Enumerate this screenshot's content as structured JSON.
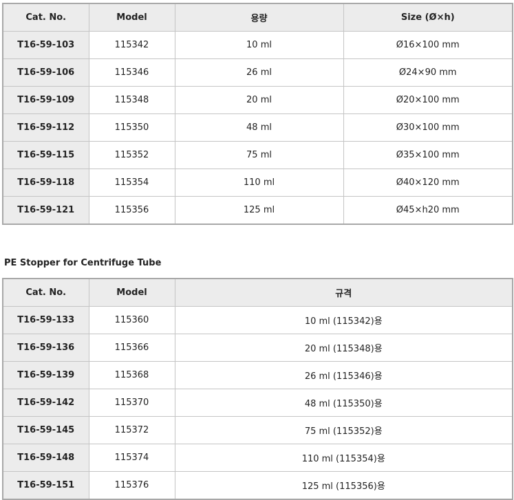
{
  "table1": {
    "headers": [
      "Cat. No.",
      "Model",
      "용량",
      "Size (Ø×h)"
    ],
    "rows": [
      [
        "T16-59-103",
        "115342",
        "10 ml",
        "Ø16×100 mm"
      ],
      [
        "T16-59-106",
        "115346",
        "26 ml",
        "Ø24×90 mm"
      ],
      [
        "T16-59-109",
        "115348",
        "20 ml",
        "Ø20×100 mm"
      ],
      [
        "T16-59-112",
        "115350",
        "48 ml",
        "Ø30×100 mm"
      ],
      [
        "T16-59-115",
        "115352",
        "75 ml",
        "Ø35×100 mm"
      ],
      [
        "T16-59-118",
        "115354",
        "110 ml",
        "Ø40×120 mm"
      ],
      [
        "T16-59-121",
        "115356",
        "125 ml",
        "Ø45×h20 mm"
      ]
    ]
  },
  "section2_title": "PE Stopper for Centrifuge Tube",
  "table2": {
    "headers": [
      "Cat. No.",
      "Model",
      "규격"
    ],
    "rows": [
      [
        "T16-59-133",
        "115360",
        "10 ml (115342)용"
      ],
      [
        "T16-59-136",
        "115366",
        "20 ml (115348)용"
      ],
      [
        "T16-59-139",
        "115368",
        "26 ml (115346)용"
      ],
      [
        "T16-59-142",
        "115370",
        "48 ml (115350)용"
      ],
      [
        "T16-59-145",
        "115372",
        "75 ml (115352)용"
      ],
      [
        "T16-59-148",
        "115374",
        "110 ml (115354)용"
      ],
      [
        "T16-59-151",
        "115376",
        "125 ml (115356)용"
      ]
    ]
  }
}
